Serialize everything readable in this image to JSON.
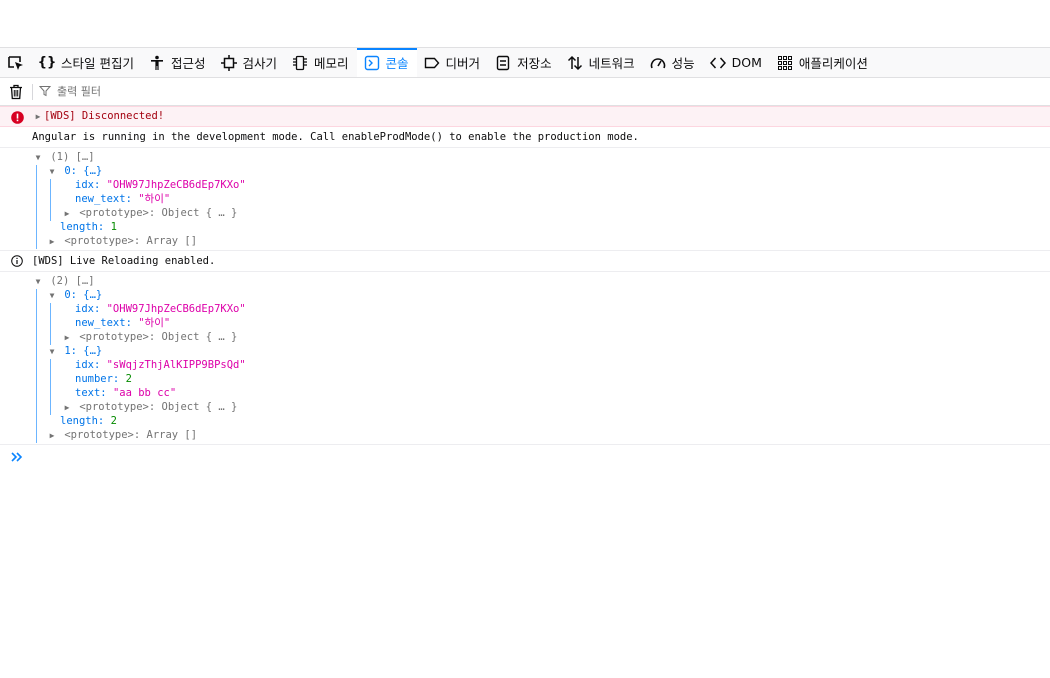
{
  "toolbar": {
    "tabs": [
      {
        "label": "스타일 편집기",
        "icon": "braces-icon"
      },
      {
        "label": "접근성",
        "icon": "accessibility-icon"
      },
      {
        "label": "검사기",
        "icon": "chip-icon"
      },
      {
        "label": "메모리",
        "icon": "memory-icon"
      },
      {
        "label": "콘솔",
        "icon": "console-icon",
        "selected": true
      },
      {
        "label": "디버거",
        "icon": "debugger-icon"
      },
      {
        "label": "저장소",
        "icon": "storage-icon"
      },
      {
        "label": "네트워크",
        "icon": "network-icon"
      },
      {
        "label": "성능",
        "icon": "performance-icon"
      },
      {
        "label": "DOM",
        "icon": "dom-icon"
      },
      {
        "label": "애플리케이션",
        "icon": "application-icon"
      }
    ]
  },
  "filter": {
    "placeholder": "출력 필터"
  },
  "console": {
    "error1": "[WDS] Disconnected!",
    "log1": "Angular is running in the development mode. Call enableProdMode() to enable the production mode.",
    "obj1": {
      "head": "(1) […]",
      "item0_head": "0: {…}",
      "idx_key": "idx: ",
      "idx_val": "\"OHW97JhpZeCB6dEp7KXo\"",
      "new_text_key": "new_text: ",
      "new_text_val": "\"하이\"",
      "proto_obj": "<prototype>: Object { … }",
      "length_key": "length: ",
      "length_val": "1",
      "proto_arr": "<prototype>: Array []"
    },
    "info1": "[WDS] Live Reloading enabled.",
    "obj2": {
      "head": "(2) […]",
      "item0_head": "0: {…}",
      "idx0_key": "idx: ",
      "idx0_val": "\"OHW97JhpZeCB6dEp7KXo\"",
      "new_text_key": "new_text: ",
      "new_text_val": "\"하이\"",
      "proto_obj0": "<prototype>: Object { … }",
      "item1_head": "1: {…}",
      "idx1_key": "idx: ",
      "idx1_val": "\"sWqjzThjAlKIPP9BPsQd\"",
      "number_key": "number: ",
      "number_val": "2",
      "text_key": "text: ",
      "text_val": "\"aa bb cc\"",
      "proto_obj1": "<prototype>: Object { … }",
      "length_key": "length: ",
      "length_val": "2",
      "proto_arr": "<prototype>: Array []"
    }
  },
  "colors": {
    "accent": "#0a84ff",
    "error": "#d70022",
    "string": "#dd00a9",
    "number": "#058b00"
  }
}
